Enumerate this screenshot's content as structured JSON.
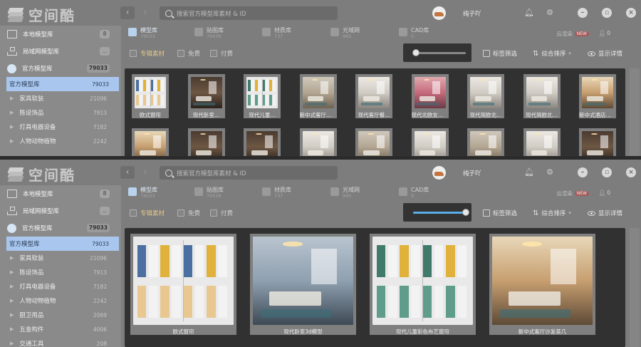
{
  "app": {
    "name": "空间酷"
  },
  "search": {
    "placeholder": "搜索官方模型库素材 & ID"
  },
  "user": {
    "name": "纯子吖"
  },
  "sidebar": {
    "local": {
      "label": "本地模型库",
      "count": "8"
    },
    "lan": {
      "label": "局域网模型库",
      "count": ".."
    },
    "official": {
      "label": "官方模型库",
      "count": "79033"
    },
    "active": {
      "label": "官方模型库",
      "count": "79033"
    },
    "items": [
      {
        "label": "家具软装",
        "count": "21096"
      },
      {
        "label": "陈设饰品",
        "count": "7913"
      },
      {
        "label": "灯具电器设备",
        "count": "7182"
      },
      {
        "label": "人物动物植物",
        "count": "2242"
      },
      {
        "label": "厨卫用品",
        "count": "2069"
      },
      {
        "label": "五金构件",
        "count": "4006"
      },
      {
        "label": "交通工具",
        "count": "208"
      }
    ]
  },
  "lib_tabs": [
    {
      "label": "模型库",
      "count": "79033"
    },
    {
      "label": "贴图库",
      "count": "70039"
    },
    {
      "label": "材质库",
      "count": "737"
    },
    {
      "label": "光域网",
      "count": "995"
    },
    {
      "label": "CAD库",
      "count": "0"
    }
  ],
  "cloud_render": {
    "label": "云渲染",
    "badge": "NEW"
  },
  "user_count": "0",
  "filters": [
    {
      "label": "专辑素材"
    },
    {
      "label": "免费"
    },
    {
      "label": "付费"
    }
  ],
  "tools": {
    "tag_filter": "标签筛选",
    "sort": "综合排序",
    "details": "显示详情"
  },
  "slider_top": {
    "value": 0.05
  },
  "slider_bottom": {
    "value": 1.0
  },
  "models_small": [
    {
      "name": "欧式窗帘",
      "art": "curtain"
    },
    {
      "name": "现代卧室...",
      "art": "room-dark"
    },
    {
      "name": "现代儿童...",
      "art": "curtain2"
    },
    {
      "name": "新中式客厅沙...",
      "art": "room-light"
    },
    {
      "name": "现代客厅餐...",
      "art": "room-white"
    },
    {
      "name": "现代北欧女儿...",
      "art": "room-pink"
    },
    {
      "name": "现代简欧北...",
      "art": "room-white"
    },
    {
      "name": "现代简欧北...",
      "art": "room-white"
    },
    {
      "name": "新中式酒店客房",
      "art": "room-warm"
    }
  ],
  "models_large": [
    {
      "name": "欧式窗帘",
      "art": "curtain"
    },
    {
      "name": "现代卧室3d模型",
      "art": "room-blue"
    },
    {
      "name": "现代儿童彩色布艺窗帘",
      "art": "curtain2"
    },
    {
      "name": "新中式客厅沙发茶几",
      "art": "room-warm"
    }
  ],
  "icons": {
    "search": "search-icon",
    "bell": "bell-icon",
    "gear": "gear-icon",
    "minimize": "minimize-icon",
    "maximize": "maximize-icon",
    "close": "close-icon"
  }
}
